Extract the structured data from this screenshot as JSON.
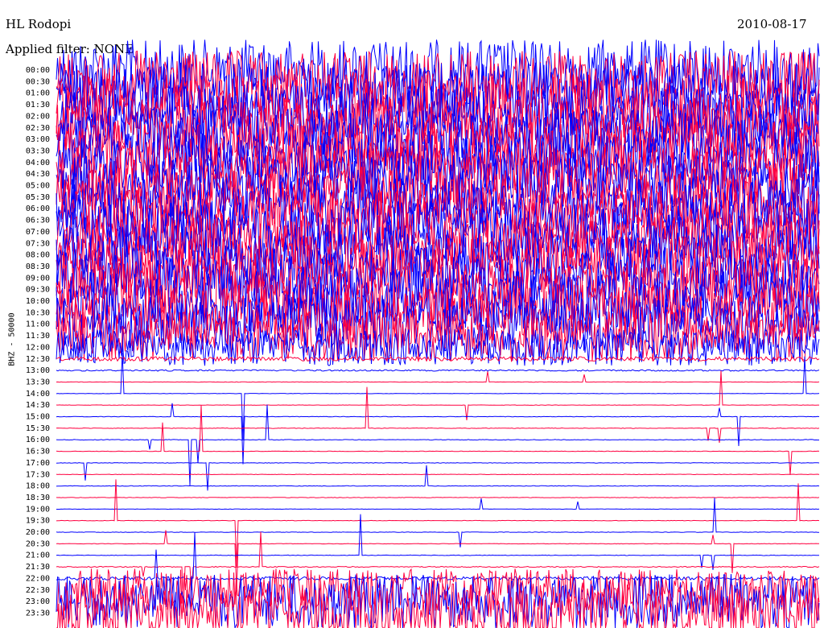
{
  "chart_data": {
    "type": "line",
    "title": "HL Rodopi",
    "date": "2010-08-17",
    "filter_text": "Applied filter: NONE",
    "channel_label": "BHZ - 50000",
    "row_interval_minutes": 30,
    "rows": [
      "00:00",
      "00:30",
      "01:00",
      "01:30",
      "02:00",
      "02:30",
      "03:00",
      "03:30",
      "04:00",
      "04:30",
      "05:00",
      "05:30",
      "06:00",
      "06:30",
      "07:00",
      "07:30",
      "08:00",
      "08:30",
      "09:00",
      "09:30",
      "10:00",
      "10:30",
      "11:00",
      "11:30",
      "12:00",
      "12:30",
      "13:00",
      "13:30",
      "14:00",
      "14:30",
      "15:00",
      "15:30",
      "16:00",
      "16:30",
      "17:00",
      "17:30",
      "18:00",
      "18:30",
      "19:00",
      "19:30",
      "20:00",
      "20:30",
      "21:00",
      "21:30",
      "22:00",
      "22:30",
      "23:00",
      "23:30"
    ],
    "series_colors": [
      "#0000ff",
      "#ff0040"
    ],
    "amplitude_level": [
      1.0,
      1.0,
      1.0,
      1.0,
      1.0,
      1.0,
      1.0,
      1.0,
      1.0,
      1.0,
      1.0,
      1.0,
      1.0,
      1.0,
      1.0,
      1.0,
      1.0,
      1.0,
      1.0,
      1.0,
      1.0,
      0.95,
      0.9,
      0.85,
      0.6,
      0.45,
      0.15,
      0.04,
      0.04,
      0.04,
      0.05,
      0.06,
      0.06,
      0.05,
      0.05,
      0.05,
      0.06,
      0.05,
      0.04,
      0.05,
      0.05,
      0.05,
      0.06,
      0.1,
      0.35,
      0.7,
      0.9,
      1.0
    ],
    "grid": false
  }
}
